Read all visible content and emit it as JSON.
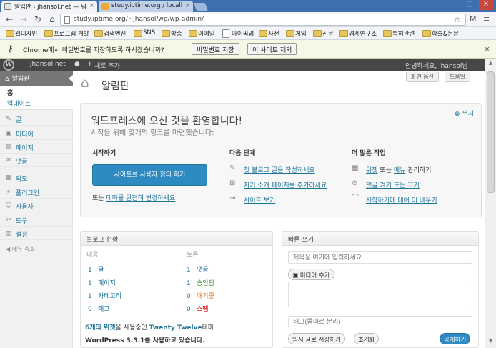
{
  "browser": {
    "tabs": [
      {
        "label": "알림판 ‹ jhansol.net — 워",
        "active": true
      },
      {
        "label": "study.iptime.org / locall",
        "active": false
      }
    ],
    "url": "study.iptime.org/~jhansol/wp/wp-admin/",
    "bookmarks": [
      "웹디자인",
      "프로그램 개발",
      "검색엔진",
      "SNS",
      "방송",
      "이메일",
      "마이픽업",
      "사전",
      "게임",
      "신문",
      "경제연구소",
      "특허관련",
      "학술&논문"
    ],
    "password_bar": {
      "message": "Chrome에서 비밀번호를 저장하도록 하시겠습니까?",
      "save": "비밀번호 저장",
      "never": "이 사이트 제외"
    }
  },
  "adminbar": {
    "site": "jhansol.net",
    "new": "새로 추가",
    "howdy": "안녕하세요, jhansol님"
  },
  "sidebar": {
    "dashboard": "알림판",
    "sub": [
      "홈",
      "업데이트"
    ],
    "items": [
      {
        "label": "글",
        "icon": "pin-icon"
      },
      {
        "label": "미디어",
        "icon": "media-icon"
      },
      {
        "label": "페이지",
        "icon": "page-icon"
      },
      {
        "label": "댓글",
        "icon": "comment-icon"
      },
      {
        "label": "외모",
        "icon": "appearance-icon"
      },
      {
        "label": "플러그인",
        "icon": "plugin-icon"
      },
      {
        "label": "사용자",
        "icon": "user-icon"
      },
      {
        "label": "도구",
        "icon": "tools-icon"
      },
      {
        "label": "설정",
        "icon": "settings-icon"
      }
    ],
    "collapse": "메뉴 축소"
  },
  "header": {
    "title": "알림판",
    "screen_options": "화면 옵션",
    "help": "도움말"
  },
  "welcome": {
    "dismiss": "무시",
    "heading": "워드프레스에 오신 것을 환영합니다!",
    "sub": "시작을 위해 몇개의 링크를 마련했습니다:",
    "col1_title": "시작하기",
    "cta": "사이트를 사용자 정의 하기",
    "alt_prefix": "또는 ",
    "alt_link": "테마를 완전히 변경하세요",
    "col2_title": "다음 단계",
    "steps": [
      "첫 블로그 글을 작성하세요",
      "자기 소개 페이지를 추가하세요",
      "사이트 보기"
    ],
    "col3_title": "더 많은 작업",
    "more": [
      {
        "link": "위젯",
        "mid": " 또는 ",
        "link2": "메뉴",
        "suffix": " 관리하기"
      },
      {
        "link": "댓글 켜기 또는 끄기"
      },
      {
        "link": "시작하기에 대해 더 배우기"
      }
    ]
  },
  "right_now": {
    "title": "블로그 현황",
    "content_h": "내용",
    "discussion_h": "토론",
    "content": [
      {
        "n": "1",
        "label": "글"
      },
      {
        "n": "1",
        "label": "페이지"
      },
      {
        "n": "1",
        "label": "카테고리"
      },
      {
        "n": "0",
        "label": "태그"
      }
    ],
    "discussion": [
      {
        "n": "1",
        "label": "댓글",
        "color": "#21759b"
      },
      {
        "n": "1",
        "label": "승인됨",
        "color": "#2e8b2e"
      },
      {
        "n": "0",
        "label": "대기중",
        "color": "#e36f12"
      },
      {
        "n": "0",
        "label": "스팸",
        "color": "#c00"
      }
    ],
    "theme_line_a": "6개의 위젯",
    "theme_line_b": "을 사용중인 ",
    "theme_line_c": "Twenty Twelve",
    "theme_line_d": "테마",
    "version": "WordPress 3.5.1를 사용하고 있습니다."
  },
  "quick_draft": {
    "title": "빠른 쓰기",
    "title_placeholder": "제목을 여기에 입력하세요",
    "media": "미디어 추가",
    "tags_placeholder": "태그(콤마로 분리)",
    "save": "임시 글로 저장하기",
    "reset": "초기화",
    "publish": "공개하기"
  }
}
